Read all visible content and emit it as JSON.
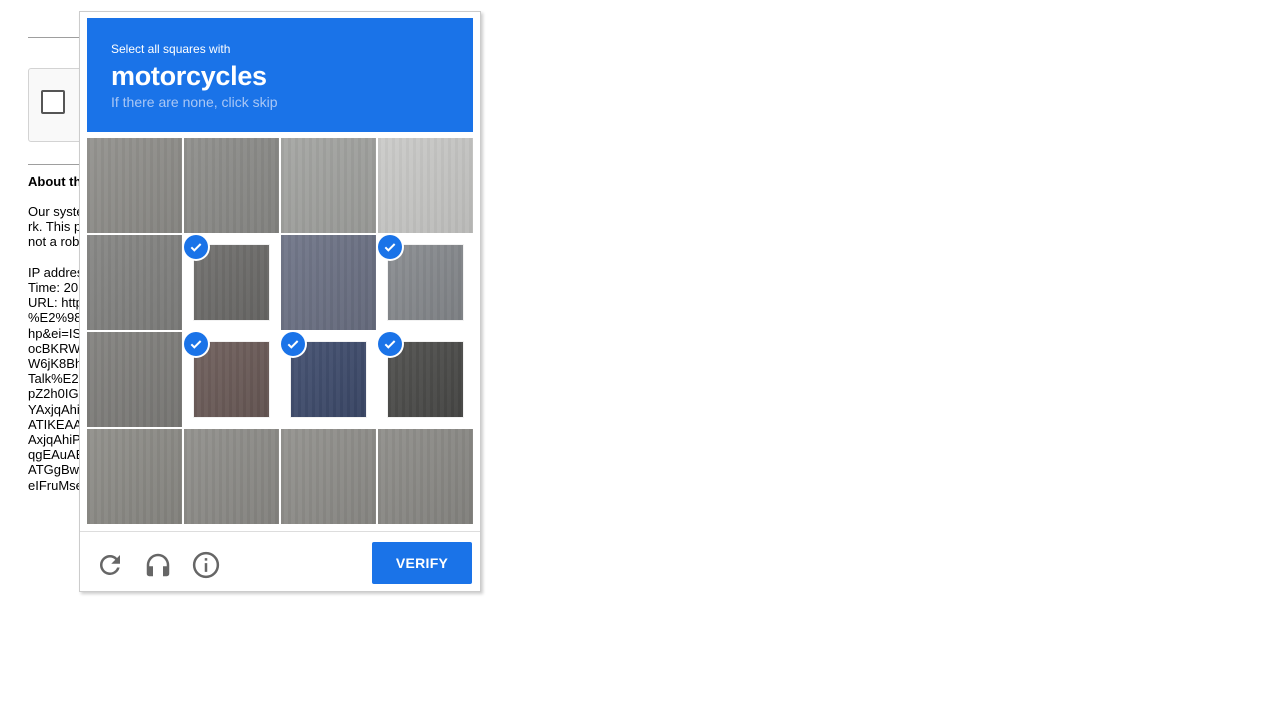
{
  "background": {
    "heading": "About th",
    "lines": [
      "Our syste",
      "rk. This p",
      "not a rob",
      "",
      "IP addres",
      "Time: 20:",
      "URL: http",
      "%E2%98",
      "hp&ei=IS",
      "ocBKRW",
      "W6jK8Bh",
      "Talk%E2",
      "pZ2h0IG",
      "YAxjqAhi",
      "ATIKEAA",
      "AxjqAhiP",
      "qgEAuAE",
      "ATGgBw",
      "eIFruMse"
    ]
  },
  "captcha": {
    "instruction_small": "Select all squares with",
    "instruction_target": "motorcycles",
    "instruction_hint": "If there are none, click skip",
    "tiles": [
      {
        "id": "1-1",
        "selected": false,
        "color": "#8f8e8a"
      },
      {
        "id": "1-2",
        "selected": false,
        "color": "#8b8b88"
      },
      {
        "id": "1-3",
        "selected": false,
        "color": "#a2a3a0"
      },
      {
        "id": "1-4",
        "selected": false,
        "color": "#c9c9c7"
      },
      {
        "id": "2-1",
        "selected": false,
        "color": "#828280"
      },
      {
        "id": "2-2",
        "selected": true,
        "color": "#6c6b69"
      },
      {
        "id": "2-3",
        "selected": false,
        "color": "#6b7184"
      },
      {
        "id": "2-4",
        "selected": true,
        "color": "#86898d"
      },
      {
        "id": "3-1",
        "selected": false,
        "color": "#7f7e7b"
      },
      {
        "id": "3-2",
        "selected": true,
        "color": "#6a5a57"
      },
      {
        "id": "3-3",
        "selected": true,
        "color": "#3d4a6b"
      },
      {
        "id": "3-4",
        "selected": true,
        "color": "#4a4a48"
      },
      {
        "id": "4-1",
        "selected": false,
        "color": "#8c8b86"
      },
      {
        "id": "4-2",
        "selected": false,
        "color": "#8d8c88"
      },
      {
        "id": "4-3",
        "selected": false,
        "color": "#8f8e8a"
      },
      {
        "id": "4-4",
        "selected": false,
        "color": "#8b8a86"
      }
    ],
    "verify_label": "VERIFY",
    "icons": [
      "reload-icon",
      "headphones-icon",
      "info-icon"
    ]
  },
  "colors": {
    "accent": "#1a73e8",
    "hint_text": "#a9c7f5"
  }
}
